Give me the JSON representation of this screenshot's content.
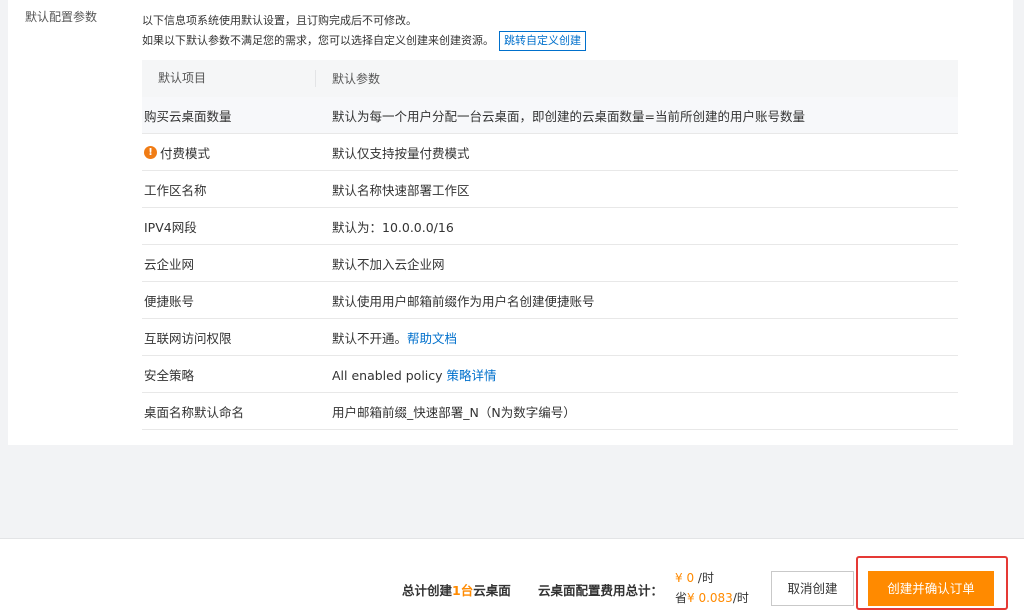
{
  "section": {
    "label": "默认配置参数",
    "notice_line1": "以下信息项系统使用默认设置，且订购完成后不可修改。",
    "notice_line2": "如果以下默认参数不满足您的需求，您可以选择自定义创建来创建资源。",
    "custom_link": "跳转自定义创建"
  },
  "table": {
    "headers": [
      "默认项目",
      "默认参数"
    ],
    "rows": [
      {
        "item": "购买云桌面数量",
        "value": "默认为每一个用户分配一台云桌面，即创建的云桌面数量=当前所创建的用户账号数量"
      },
      {
        "item": "付费模式",
        "value": "默认仅支持按量付费模式",
        "icon": "warning-icon"
      },
      {
        "item": "工作区名称",
        "value": "默认名称快速部署工作区"
      },
      {
        "item": "IPV4网段",
        "value": "默认为：10.0.0.0/16"
      },
      {
        "item": "云企业网",
        "value": "默认不加入云企业网"
      },
      {
        "item": "便捷账号",
        "value": "默认使用用户邮箱前缀作为用户名创建便捷账号"
      },
      {
        "item": "互联网访问权限",
        "value": "默认不开通。",
        "link": "帮助文档"
      },
      {
        "item": "安全策略",
        "value": "All enabled policy ",
        "link": "策略详情"
      },
      {
        "item": "桌面名称默认命名",
        "value": "用户邮箱前缀_快速部署_N（N为数字编号）"
      }
    ]
  },
  "footer": {
    "summary_prefix": "总计创建",
    "summary_count": "1台",
    "summary_suffix": "云桌面",
    "cost_label": "云桌面配置费用总计：",
    "price": "¥ 0",
    "price_unit": " /时",
    "save_prefix": "省",
    "save_price": "¥ 0.083",
    "save_unit": "/时",
    "cancel_label": "取消创建",
    "confirm_label": "创建并确认订单"
  },
  "colors": {
    "accent": "#ff8a00",
    "link": "#0070cc",
    "highlight_frame": "#e53935"
  }
}
